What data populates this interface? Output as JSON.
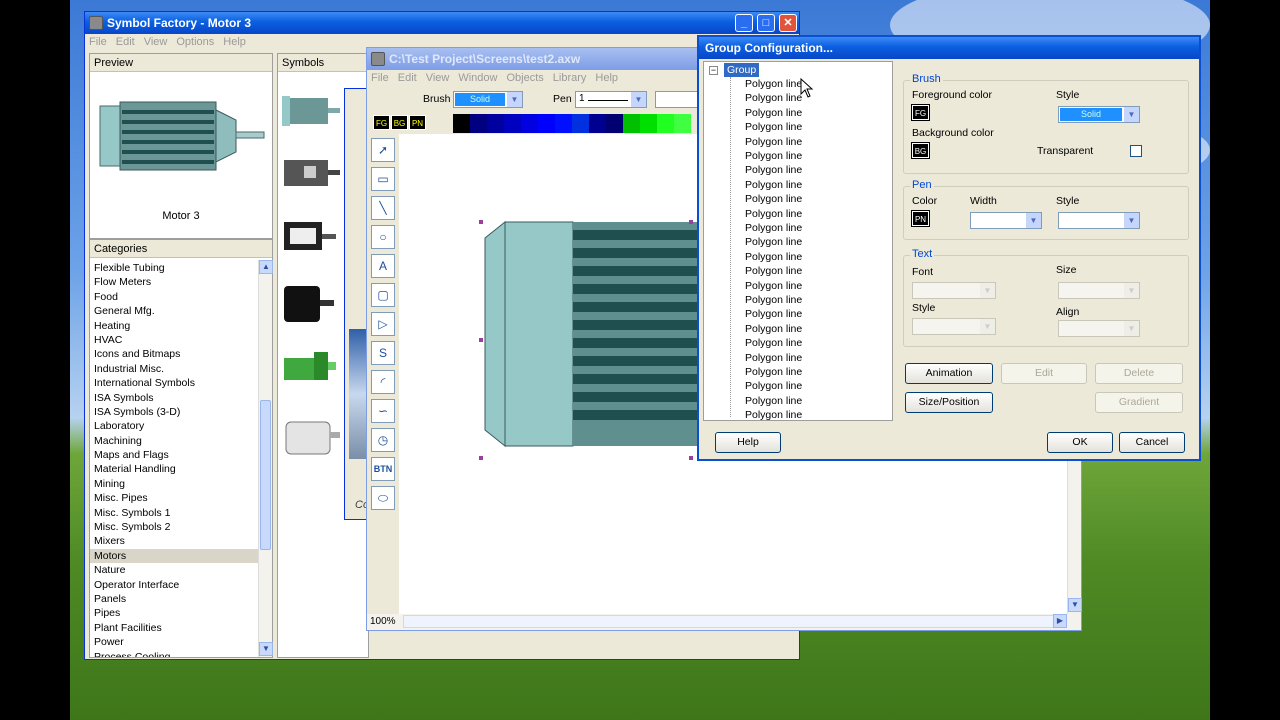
{
  "symbol_factory": {
    "title": "Symbol Factory - Motor 3",
    "menu": [
      "File",
      "Edit",
      "View",
      "Options",
      "Help"
    ],
    "preview_header": "Preview",
    "preview_caption": "Motor 3",
    "symbols_header": "Symbols",
    "categories_header": "Categories",
    "categories": [
      "Flexible Tubing",
      "Flow Meters",
      "Food",
      "General Mfg.",
      "Heating",
      "HVAC",
      "Icons and Bitmaps",
      "Industrial Misc.",
      "International Symbols",
      "ISA Symbols",
      "ISA Symbols (3-D)",
      "Laboratory",
      "Machining",
      "Maps and Flags",
      "Material Handling",
      "Mining",
      "Misc. Pipes",
      "Misc. Symbols 1",
      "Misc. Symbols 2",
      "Mixers",
      "Motors",
      "Nature",
      "Operator Interface",
      "Panels",
      "Pipes",
      "Plant Facilities",
      "Power",
      "Process Cooling"
    ],
    "selected_category": "Motors"
  },
  "editor": {
    "title": "C:\\Test Project\\Screens\\test2.axw",
    "menu": [
      "File",
      "Edit",
      "View",
      "Window",
      "Objects",
      "Library",
      "Help"
    ],
    "brush_label": "Brush",
    "brush_value": "Solid",
    "pen_label": "Pen",
    "pen_value": "1",
    "fg": "FG",
    "bg": "BG",
    "pn": "PN",
    "zoom": "100%",
    "palette": [
      "#000000",
      "#000080",
      "#0000a0",
      "#0000c0",
      "#0000e0",
      "#0000ff",
      "#0010ff",
      "#0030e0",
      "#000090",
      "#000070",
      "#00c000",
      "#00e000",
      "#20ff20",
      "#40ff40"
    ],
    "tools": [
      "arrow",
      "rect",
      "line",
      "circle",
      "A",
      "rounded",
      "polygon",
      "S",
      "arc",
      "wave",
      "clock",
      "BTN",
      "ellipse"
    ],
    "behind_window_stub": "Co"
  },
  "dialog": {
    "title": "Group Configuration...",
    "tree_root": "Group",
    "tree_items": [
      "Polygon line",
      "Polygon line",
      "Polygon line",
      "Polygon line",
      "Polygon line",
      "Polygon line",
      "Polygon line",
      "Polygon line",
      "Polygon line",
      "Polygon line",
      "Polygon line",
      "Polygon line",
      "Polygon line",
      "Polygon line",
      "Polygon line",
      "Polygon line",
      "Polygon line",
      "Polygon line",
      "Polygon line",
      "Polygon line",
      "Polygon line",
      "Polygon line",
      "Polygon line",
      "Polygon line"
    ],
    "brush_group": "Brush",
    "fg_color_label": "Foreground color",
    "fg_swatch": "FG",
    "bg_color_label": "Background color",
    "bg_swatch": "BG",
    "style_label": "Style",
    "brush_style": "Solid",
    "transparent_label": "Transparent",
    "pen_group": "Pen",
    "color_label": "Color",
    "pn_swatch": "PN",
    "width_label": "Width",
    "pen_style_label": "Style",
    "text_group": "Text",
    "font_label": "Font",
    "size_label": "Size",
    "text_style_label": "Style",
    "align_label": "Align",
    "buttons": {
      "animation": "Animation",
      "edit": "Edit",
      "delete": "Delete",
      "size_position": "Size/Position",
      "gradient": "Gradient",
      "help": "Help",
      "ok": "OK",
      "cancel": "Cancel"
    }
  },
  "colors": {
    "titlebar": "#0a5fe0",
    "selection": "#316ac5",
    "motor_body": "#96c8c8",
    "motor_dark": "#1f4f4f"
  }
}
